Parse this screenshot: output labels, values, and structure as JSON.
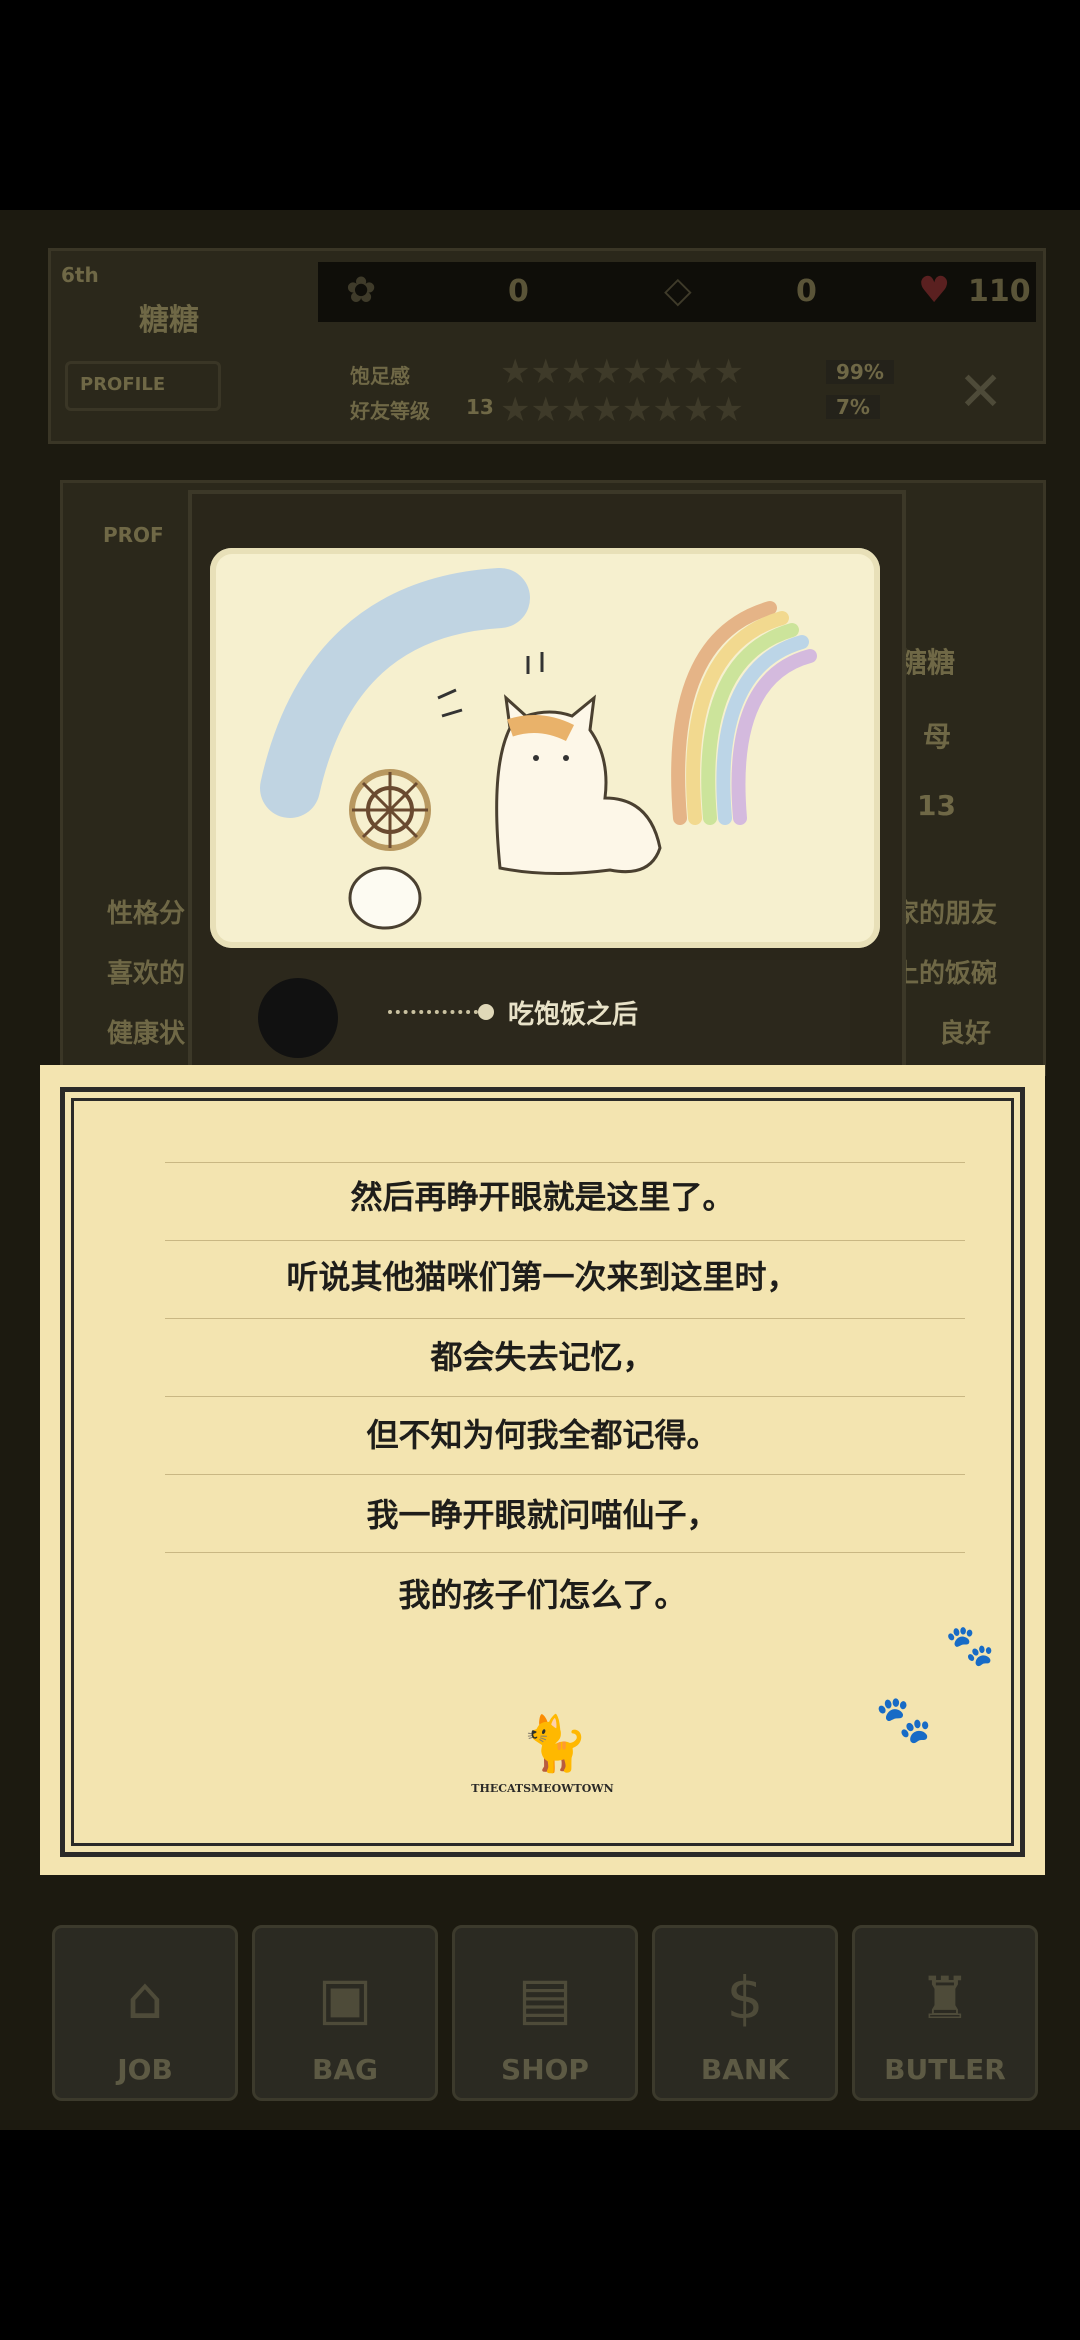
{
  "header": {
    "rank": "6th",
    "cat_name": "糖糖",
    "profile_button": "PROFILE",
    "paw_count": "0",
    "gem_count": "0",
    "heart_count": "110",
    "fullness_label": "饱足感",
    "friend_level_label": "好友等级",
    "friend_level": "13",
    "fullness_percent": "99%",
    "friend_percent": "7%",
    "close_icon": "x-icon"
  },
  "profile": {
    "label": "PROF",
    "name": "糖糖",
    "gender": "母",
    "level": "13",
    "personality_label": "性格分",
    "personality_value": "家的朋友",
    "likes_label": "喜欢的",
    "likes_value": "上的饭碗",
    "health_label": "健康状",
    "health_value": "良好"
  },
  "card": {
    "tab_label": "",
    "recipe_text": "吃饱饭之后"
  },
  "dialog": {
    "lines": [
      "然后再睁开眼就是这里了。",
      "听说其他猫咪们第一次来到这里时，",
      "都会失去记忆，",
      "但不知为何我全都记得。",
      "我一睁开眼就问喵仙子，",
      "我的孩子们怎么了。"
    ],
    "brand": "THECATSMEOWTOWN"
  },
  "nav": [
    {
      "label": "JOB",
      "icon": "house-icon"
    },
    {
      "label": "BAG",
      "icon": "bag-icon"
    },
    {
      "label": "SHOP",
      "icon": "basket-icon"
    },
    {
      "label": "BANK",
      "icon": "dollar-icon"
    },
    {
      "label": "BUTLER",
      "icon": "tophat-icon"
    }
  ],
  "colors": {
    "paper": "#f3e4b0",
    "ink": "#1e1d1a",
    "dim_bg": "#1c1a10"
  }
}
